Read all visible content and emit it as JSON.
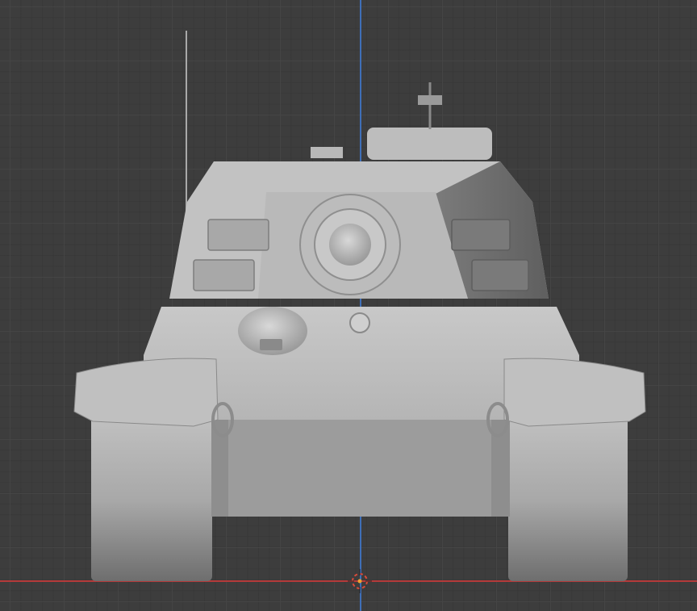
{
  "viewport": {
    "view": "front-orthographic",
    "colors": {
      "background": "#3d3d3d",
      "grid_major": "#474747",
      "axis_x": "#b53a3a",
      "axis_z": "#3f6fb8",
      "model_light": "#c9c9c9",
      "model_mid": "#9b9b9b",
      "model_dark": "#6f6f6f"
    },
    "objects": {
      "model": "tank-model",
      "cursor": "3d-cursor-icon",
      "origin": "world-origin"
    }
  }
}
